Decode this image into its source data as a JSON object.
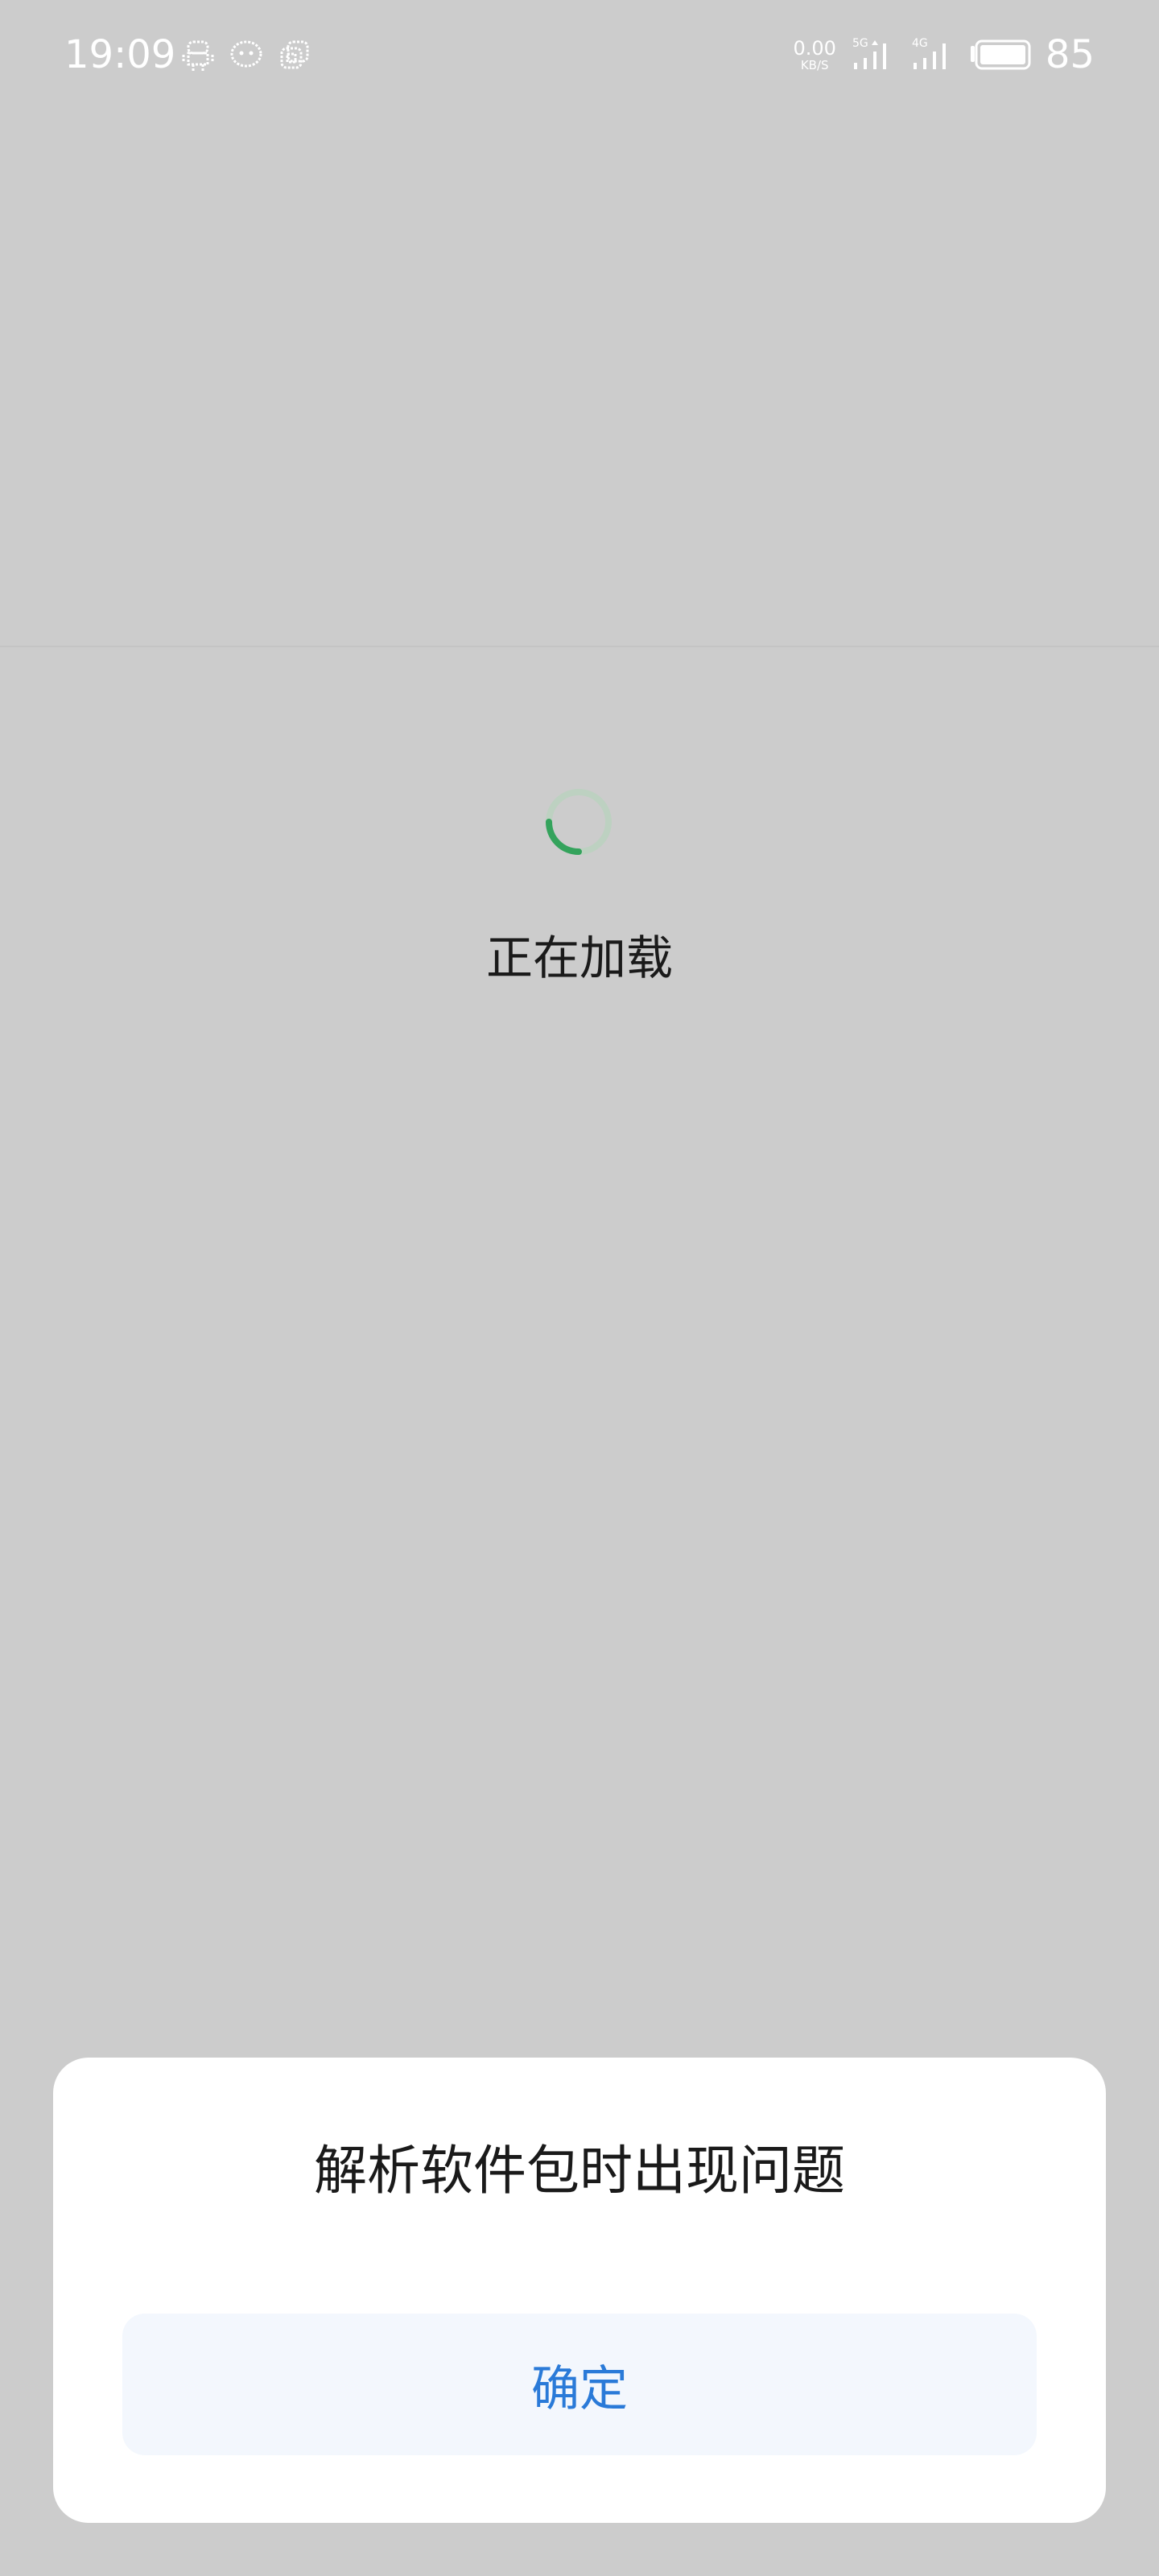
{
  "status_bar": {
    "time": "19:09",
    "net_speed_value": "0.00",
    "net_speed_unit": "KB/S",
    "signal_1_label": "5G",
    "signal_2_label": "4G",
    "battery_percent": "85",
    "notification_icons": [
      "android-robot-icon",
      "chat-bubble-icon",
      "app-store-icon"
    ]
  },
  "main": {
    "loading_text": "正在加载",
    "spinner_colors": {
      "track": "#bdd1c1",
      "arc": "#34a35c"
    }
  },
  "dialog": {
    "title": "解析软件包时出现问题",
    "confirm_label": "确定",
    "accent_color": "#2a7ad8"
  }
}
